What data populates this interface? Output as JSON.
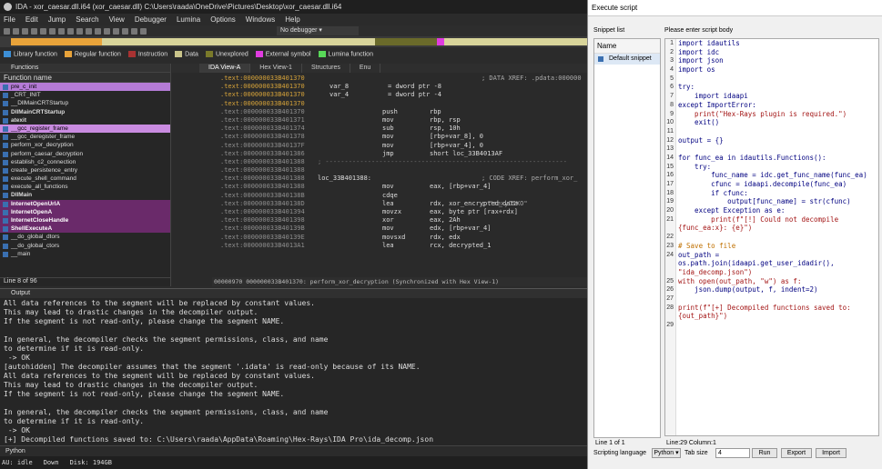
{
  "window": {
    "title": "IDA - xor_caesar.dll.i64 (xor_caesar.dll) C:\\Users\\raada\\OneDrive\\Pictures\\Desktop\\xor_caesar.dll.i64"
  },
  "menu": [
    "File",
    "Edit",
    "Jump",
    "Search",
    "View",
    "Debugger",
    "Lumina",
    "Options",
    "Windows",
    "Help"
  ],
  "toolbar": {
    "debugger": "No debugger"
  },
  "legend": [
    "Library function",
    "Regular function",
    "Instruction",
    "Data",
    "Unexplored",
    "External symbol",
    "Lumina function"
  ],
  "legend_colors": [
    "#3d8fd6",
    "#e8a33a",
    "#a83232",
    "#c9c48a",
    "#7a7a2a",
    "#e03ce0",
    "#58d858"
  ],
  "functions": {
    "title": "Functions",
    "header": "Function name",
    "footer": "Line 8 of 96",
    "items": [
      "pre_c_init",
      "_CRT_INIT",
      "__DllMainCRTStartup",
      "DllMainCRTStartup",
      "atexit",
      "__gcc_register_frame",
      "__gcc_deregister_frame",
      "perform_xor_decryption",
      "perform_caesar_decryption",
      "establish_c2_connection",
      "create_persistence_entry",
      "execute_shell_command",
      "execute_all_functions",
      "DllMain",
      "InternetOpenUrlA",
      "InternetOpenA",
      "InternetCloseHandle",
      "ShellExecuteA",
      "__do_global_dtors",
      "__do_global_ctors",
      "__main"
    ]
  },
  "tabs": [
    "IDA View-A",
    "Hex View-1",
    "Structures",
    "Enu"
  ],
  "ida": {
    "status": "00000970 000000033B401370: perform_xor_decryption (Synchronized with Hex View-1)",
    "lines": [
      {
        "a": ".text:000000033B401370",
        "t": "",
        "c": "; DATA XREF: .pdata:000000"
      },
      {
        "a": ".text:000000033B401370",
        "var": "var_8",
        "val": "= dword ptr -8"
      },
      {
        "a": ".text:000000033B401370",
        "var": "var_4",
        "val": "= dword ptr -4"
      },
      {
        "a": ".text:000000033B401370"
      },
      {
        "a": ".text:000000033B401370",
        "m": "push",
        "o": "rbp"
      },
      {
        "a": ".text:000000033B401371",
        "m": "mov",
        "o": "rbp, rsp"
      },
      {
        "a": ".text:000000033B401374",
        "m": "sub",
        "o": "rsp, 10h"
      },
      {
        "a": ".text:000000033B401378",
        "m": "mov",
        "o": "[rbp+var_8], 0"
      },
      {
        "a": ".text:000000033B40137F",
        "m": "mov",
        "o": "[rbp+var_4], 0"
      },
      {
        "a": ".text:000000033B401386",
        "m": "jmp",
        "o": "short loc_33B4013AF"
      },
      {
        "a": ".text:000000033B401388",
        "sep": "; ---------------------------------------------------------------"
      },
      {
        "a": ".text:000000033B401388"
      },
      {
        "a": ".text:000000033B401388",
        "lbl": "loc_33B401388:",
        "c": "; CODE XREF: perform_xor_"
      },
      {
        "a": ".text:000000033B401388",
        "m": "mov",
        "o": "eax, [rbp+var_4]"
      },
      {
        "a": ".text:000000033B40138B",
        "m": "cdqe",
        "o": ""
      },
      {
        "a": ".text:000000033B40138D",
        "m": "lea",
        "o": "rdx, xor_encrypted_data",
        "c": "; \"rexyOIXO\""
      },
      {
        "a": ".text:000000033B401394",
        "m": "movzx",
        "o": "eax, byte ptr [rax+rdx]"
      },
      {
        "a": ".text:000000033B401398",
        "m": "xor",
        "o": "eax, 2Ah"
      },
      {
        "a": ".text:000000033B40139B",
        "m": "mov",
        "o": "edx, [rbp+var_4]"
      },
      {
        "a": ".text:000000033B40139E",
        "m": "movsxd",
        "o": "rdx, edx"
      },
      {
        "a": ".text:000000033B4013A1",
        "m": "lea",
        "o": "rcx, decrypted_1"
      }
    ]
  },
  "output": {
    "title": "Output",
    "lines": [
      "All data references to the segment will be replaced by constant values.",
      "This may lead to drastic changes in the decompiler output.",
      "If the segment is not read-only, please change the segment NAME.",
      "",
      "In general, the decompiler checks the segment permissions, class, and name",
      "to determine if it is read-only.",
      " -> OK",
      "[autohidden] The decompiler assumes that the segment '.idata' is read-only because of its NAME.",
      "All data references to the segment will be replaced by constant values.",
      "This may lead to drastic changes in the decompiler output.",
      "If the segment is not read-only, please change the segment NAME.",
      "",
      "In general, the decompiler checks the segment permissions, class, and name",
      "to determine if it is read-only.",
      " -> OK",
      "[+] Decompiled functions saved to: C:\\Users\\raada\\AppData\\Roaming\\Hex-Rays\\IDA Pro\\ida_decomp.json"
    ],
    "lang": "Python"
  },
  "status": {
    "au": "AU:  idle",
    "dir": "Down",
    "disk": "Disk: 194GB"
  },
  "dialog": {
    "title": "Execute script",
    "snippet_list": "Snippet list",
    "snippet_header": "Name",
    "snippet_item": "Default snippet",
    "body_label": "Please enter script body",
    "code": [
      "import idautils",
      "import idc",
      "import json",
      "import os",
      "",
      "try:",
      "    import idaapi",
      "except ImportError:",
      "    print(\"Hex-Rays plugin is required.\")",
      "    exit()",
      "",
      "output = {}",
      "",
      "for func_ea in idautils.Functions():",
      "    try:",
      "        func_name = idc.get_func_name(func_ea)",
      "        cfunc = idaapi.decompile(func_ea)",
      "        if cfunc:",
      "            output[func_name] = str(cfunc)",
      "    except Exception as e:",
      "        print(f\"[!] Could not decompile",
      "{func_ea:x}: {e}\")",
      "",
      "# Save to file",
      "out_path =",
      "os.path.join(idaapi.get_user_idadir(),",
      "\"ida_decomp.json\")",
      "with open(out_path, \"w\") as f:",
      "    json.dump(output, f, indent=2)",
      "",
      "print(f\"[+] Decompiled functions saved to:",
      "{out_path}\")"
    ],
    "gutter": [
      "1",
      "2",
      "3",
      "4",
      "5",
      "6",
      "7",
      "8",
      "9",
      "10",
      "11",
      "12",
      "13",
      "14",
      "15",
      "16",
      "17",
      "18",
      "19",
      "20",
      "21",
      "",
      "22",
      "23",
      "24",
      "",
      "",
      "25",
      "26",
      "27",
      "28",
      "",
      "29"
    ],
    "snip_status": "Line 1 of 1",
    "editor_status": "Line:29  Column:1",
    "lang_label": "Scripting language",
    "lang": "Python",
    "tab_label": "Tab size",
    "tab": "4",
    "run": "Run",
    "export": "Export",
    "import": "Import"
  }
}
